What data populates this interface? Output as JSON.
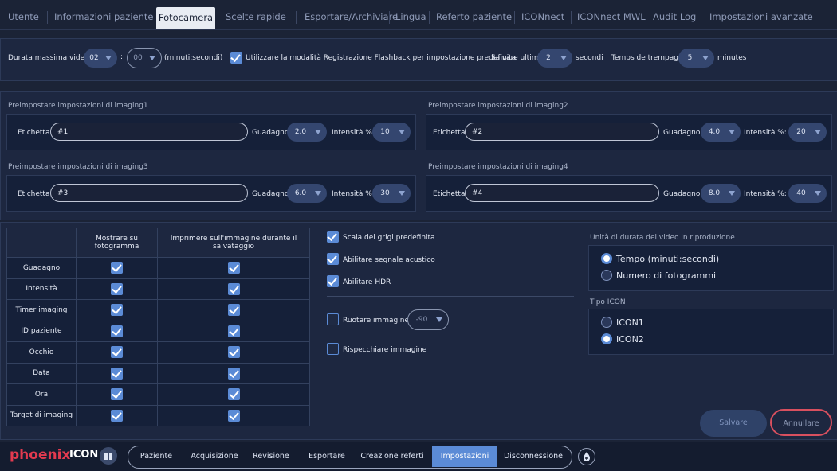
{
  "tabs": [
    {
      "label": "Utente",
      "active": false
    },
    {
      "label": "Informazioni paziente",
      "active": false
    },
    {
      "label": "Fotocamera",
      "active": true
    },
    {
      "label": "Scelte rapide",
      "active": false
    },
    {
      "label": "Esportare/Archiviare",
      "active": false
    },
    {
      "label": "Lingua",
      "active": false
    },
    {
      "label": "Referto paziente",
      "active": false
    },
    {
      "label": "ICONnect",
      "active": false
    },
    {
      "label": "ICONnect MWL",
      "active": false
    },
    {
      "label": "Audit Log",
      "active": false
    },
    {
      "label": "Impostazioni avanzate",
      "active": false
    }
  ],
  "video": {
    "max_duration_label": "Durata massima video",
    "minutes": "02",
    "colon": ":",
    "seconds": "00",
    "unit_label": "(minuti:secondi)",
    "flashback_label": "Utilizzare la modalità Registrazione Flashback per impostazione predefinita",
    "flashback_checked": true,
    "save_last_label": "Salvare ultimi",
    "save_last_value": "2",
    "seconds_label": "secondi",
    "trempage_label": "Temps de trempage",
    "trempage_value": "5",
    "minutes_label": "minutes"
  },
  "presets": [
    {
      "title": "Preimpostare impostazioni di imaging1",
      "label_caption": "Etichetta:",
      "label_value": "#1",
      "gain_caption": "Guadagno:",
      "gain": "2.0",
      "intensity_caption": "Intensità %:",
      "intensity": "10"
    },
    {
      "title": "Preimpostare impostazioni di imaging2",
      "label_caption": "Etichetta:",
      "label_value": "#2",
      "gain_caption": "Guadagno:",
      "gain": "4.0",
      "intensity_caption": "Intensità %:",
      "intensity": "20"
    },
    {
      "title": "Preimpostare impostazioni di imaging3",
      "label_caption": "Etichetta:",
      "label_value": "#3",
      "gain_caption": "Guadagno:",
      "gain": "6.0",
      "intensity_caption": "Intensità %:",
      "intensity": "30"
    },
    {
      "title": "Preimpostare impostazioni di imaging4",
      "label_caption": "Etichetta:",
      "label_value": "#4",
      "gain_caption": "Guadagno:",
      "gain": "8.0",
      "intensity_caption": "Intensità %:",
      "intensity": "40"
    }
  ],
  "overlay_table": {
    "headers": [
      "",
      "Mostrare su fotogramma",
      "Imprimere sull'immagine durante il salvataggio"
    ],
    "rows": [
      {
        "label": "Guadagno",
        "show": true,
        "imprint": true
      },
      {
        "label": "Intensità",
        "show": true,
        "imprint": true
      },
      {
        "label": "Timer imaging",
        "show": true,
        "imprint": true
      },
      {
        "label": "ID paziente",
        "show": true,
        "imprint": true
      },
      {
        "label": "Occhio",
        "show": true,
        "imprint": true
      },
      {
        "label": "Data",
        "show": true,
        "imprint": true
      },
      {
        "label": "Ora",
        "show": true,
        "imprint": true
      },
      {
        "label": "Target di imaging",
        "show": true,
        "imprint": true
      }
    ]
  },
  "options": {
    "grayscale": {
      "label": "Scala dei grigi predefinita",
      "checked": true
    },
    "beep": {
      "label": "Abilitare segnale acustico",
      "checked": true
    },
    "hdr": {
      "label": "Abilitare HDR",
      "checked": true
    },
    "rotate": {
      "label": "Ruotare immagine",
      "checked": false,
      "value": "-90"
    },
    "mirror": {
      "label": "Rispecchiare immagine",
      "checked": false
    }
  },
  "playback": {
    "title": "Unità di durata del video in riproduzione",
    "options": [
      {
        "label": "Tempo (minuti:secondi)",
        "selected": true
      },
      {
        "label": "Numero di fotogrammi",
        "selected": false
      }
    ]
  },
  "icon_type": {
    "title": "Tipo ICON",
    "options": [
      {
        "label": "ICON1",
        "selected": false
      },
      {
        "label": "ICON2",
        "selected": true
      }
    ]
  },
  "actions": {
    "save": "Salvare",
    "cancel": "Annullare"
  },
  "bottom": {
    "brand": "phoenix",
    "brand2": "ICON",
    "nav": [
      {
        "label": "Paziente",
        "active": false
      },
      {
        "label": "Acquisizione",
        "active": false
      },
      {
        "label": "Revisione",
        "active": false
      },
      {
        "label": "Esportare",
        "active": false
      },
      {
        "label": "Creazione referti",
        "active": false
      },
      {
        "label": "Impostazioni",
        "active": true
      },
      {
        "label": "Disconnessione",
        "active": false
      }
    ]
  },
  "colors": {
    "accent": "#5b8bd6",
    "background": "#1b2336",
    "cancel_border": "#d9505f",
    "brand": "#e23a4f"
  }
}
